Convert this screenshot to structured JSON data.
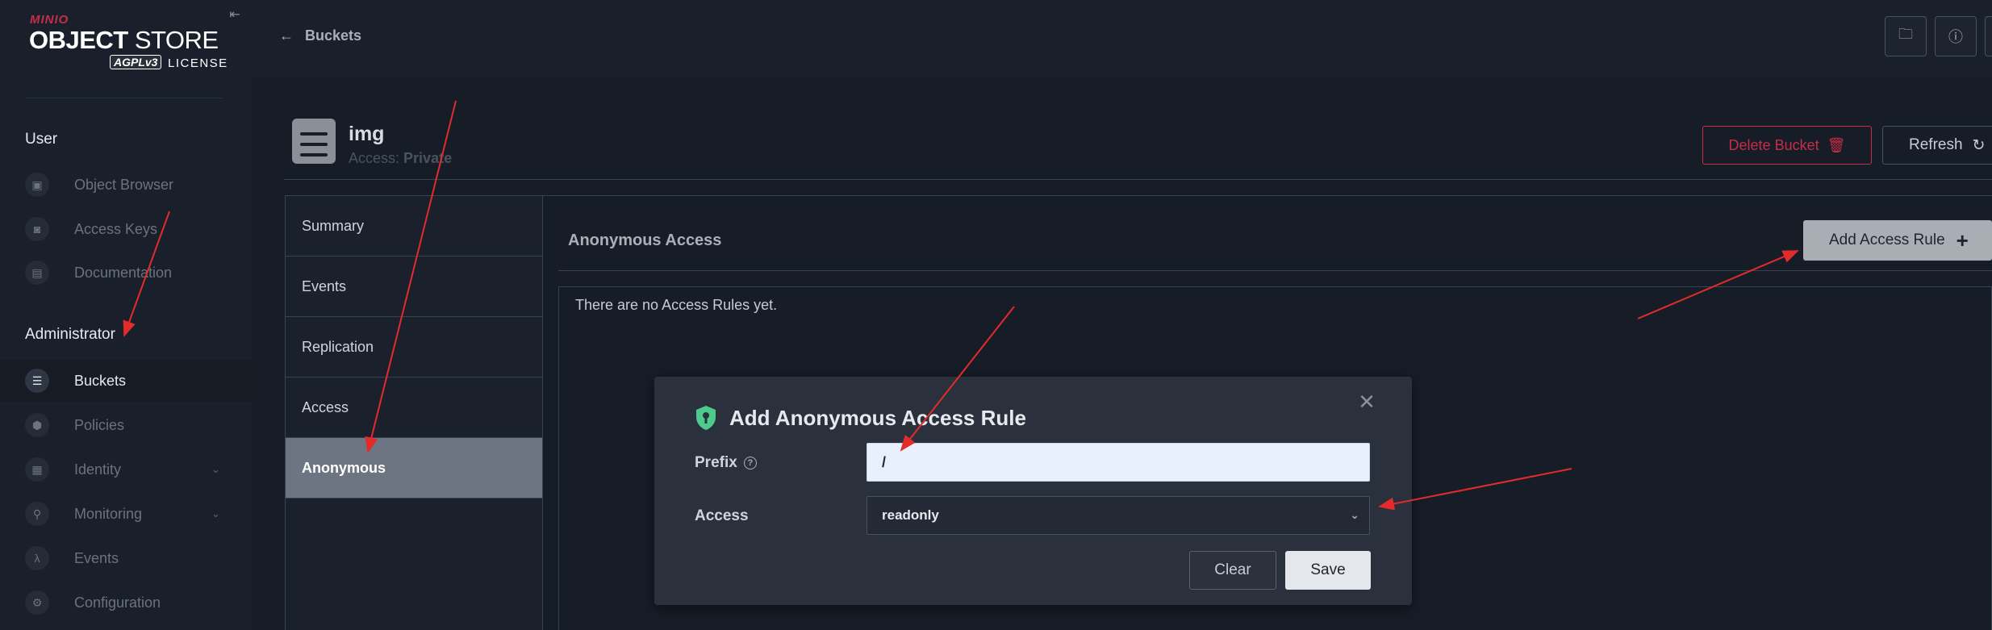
{
  "brand": {
    "mini": "MINIO",
    "object": "OBJECT",
    "store": "STORE",
    "agpl": "AGPLv3",
    "license": "LICENSE"
  },
  "sidebar": {
    "user_section": "User",
    "user_items": [
      {
        "label": "Object Browser",
        "icon": "object-browser-icon"
      },
      {
        "label": "Access Keys",
        "icon": "access-keys-icon"
      },
      {
        "label": "Documentation",
        "icon": "documentation-icon"
      }
    ],
    "admin_section": "Administrator",
    "admin_items": [
      {
        "label": "Buckets",
        "icon": "bucket-icon",
        "active": true
      },
      {
        "label": "Policies",
        "icon": "policies-icon"
      },
      {
        "label": "Identity",
        "icon": "identity-icon",
        "expandable": true
      },
      {
        "label": "Monitoring",
        "icon": "monitoring-icon",
        "expandable": true
      },
      {
        "label": "Events",
        "icon": "lambda-icon"
      },
      {
        "label": "Configuration",
        "icon": "gear-icon"
      }
    ]
  },
  "topbar": {
    "back_label": "Buckets"
  },
  "bucket": {
    "name": "img",
    "access_label": "Access:",
    "access_value": "Private",
    "delete_label": "Delete Bucket",
    "refresh_label": "Refresh"
  },
  "tabs": [
    {
      "label": "Summary"
    },
    {
      "label": "Events"
    },
    {
      "label": "Replication"
    },
    {
      "label": "Access"
    },
    {
      "label": "Anonymous",
      "active": true
    }
  ],
  "content": {
    "title": "Anonymous Access",
    "add_rule_label": "Add Access Rule",
    "empty_message": "There are no Access Rules yet."
  },
  "modal": {
    "title": "Add Anonymous Access Rule",
    "prefix_label": "Prefix",
    "prefix_value": "/",
    "access_label": "Access",
    "access_value": "readonly",
    "clear_label": "Clear",
    "save_label": "Save"
  },
  "colors": {
    "accent_red": "#c72c48",
    "shield_green": "#4ccb8d",
    "annotation_red": "#e32b2b"
  }
}
